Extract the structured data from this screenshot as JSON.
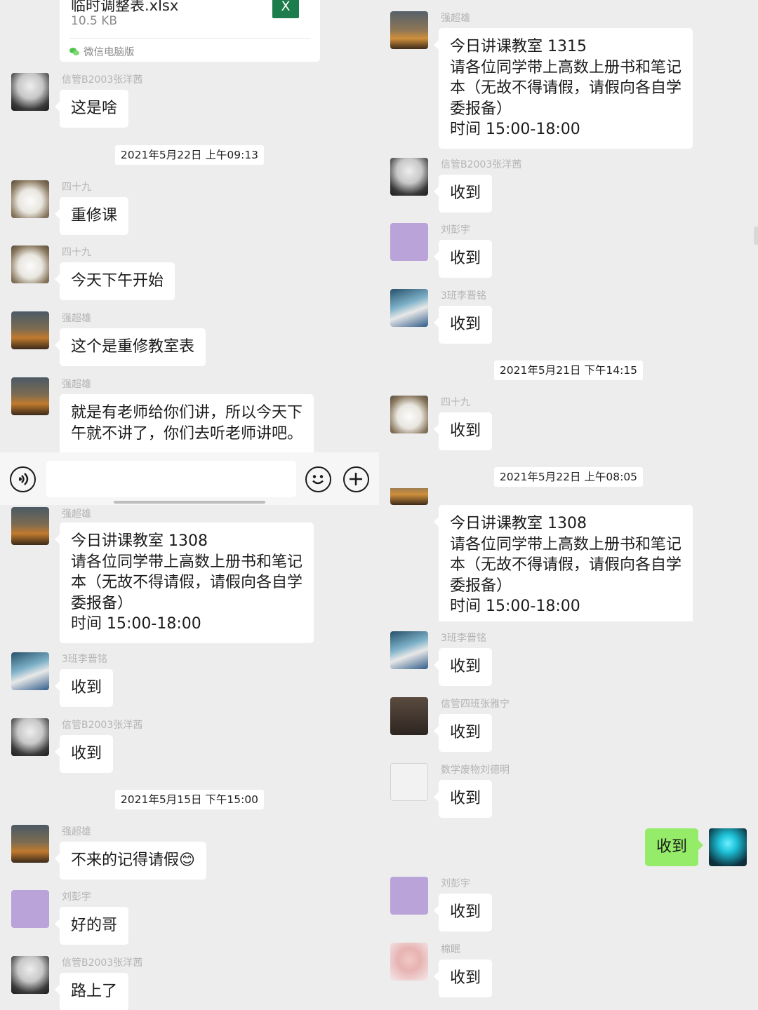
{
  "left": {
    "file": {
      "name": "临时调整表.xlsx",
      "size": "10.5 KB",
      "source": "微信电脑版",
      "type_icon": "X"
    },
    "msgs": [
      {
        "sender": "信管B2003张洋茜",
        "text": "这是啥"
      },
      {
        "sender": "四十九",
        "text": "重修课"
      },
      {
        "sender": "四十九",
        "text": "今天下午开始"
      },
      {
        "sender": "强超雄",
        "text": "这个是重修教室表"
      },
      {
        "sender": "强超雄",
        "text": "就是有老师给你们讲，所以今天下\n午就不讲了，你们去听老师讲吧。"
      },
      {
        "sender": "强超雄",
        "text": "今日讲课教室 1308\n请各位同学带上高数上册书和笔记\n本（无故不得请假，请假向各自学\n委报备）\n时间 15:00-18:00"
      },
      {
        "sender": "3班李晋铭",
        "text": "收到"
      },
      {
        "sender": "信管B2003张洋茜",
        "text": "收到"
      },
      {
        "sender": "强超雄",
        "text": "不来的记得请假😊"
      },
      {
        "sender": "刘彭宇",
        "text": "好的哥"
      },
      {
        "sender": "信管B2003张洋茜",
        "text": "路上了"
      }
    ],
    "timestamps": [
      "2021年5月22日 上午09:13",
      "2021年5月15日 下午15:00"
    ]
  },
  "right": {
    "msgs": [
      {
        "sender": "强超雄",
        "text": "今日讲课教室 1315\n请各位同学带上高数上册书和笔记\n本（无故不得请假，请假向各自学\n委报备）\n时间 15:00-18:00"
      },
      {
        "sender": "信管B2003张洋茜",
        "text": "收到"
      },
      {
        "sender": "刘彭宇",
        "text": "收到"
      },
      {
        "sender": "3班李晋铭",
        "text": "收到"
      },
      {
        "sender": "四十九",
        "text": "收到"
      },
      {
        "sender": "",
        "text": "今日讲课教室 1308\n请各位同学带上高数上册书和笔记\n本（无故不得请假，请假向各自学\n委报备）\n时间 15:00-18:00"
      },
      {
        "sender": "3班李晋铭",
        "text": "收到"
      },
      {
        "sender": "信管四班张雅宁",
        "text": "收到"
      },
      {
        "sender": "数学废物刘德明",
        "text": "收到"
      },
      {
        "sender": "刘彭宇",
        "text": "收到"
      },
      {
        "sender": "棉眠",
        "text": "收到"
      }
    ],
    "self_msg": {
      "text": "收到"
    },
    "timestamps": [
      "2021年5月21日 下午14:15",
      "2021年5月22日 上午08:05"
    ]
  },
  "input_bar": {
    "placeholder": "",
    "icons": [
      "voice-icon",
      "emoji-icon",
      "plus-icon"
    ]
  },
  "colors": {
    "background": "#ededed",
    "bubble_other": "#ffffff",
    "bubble_self": "#95ec69",
    "sender_name": "#b4b4b4"
  }
}
